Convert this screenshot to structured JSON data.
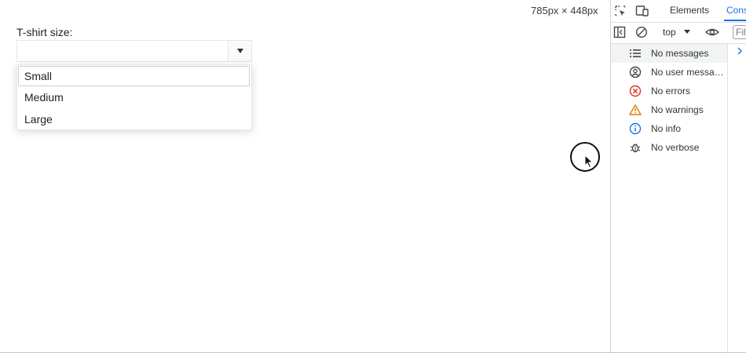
{
  "viewport": {
    "dimensions": "785px × 448px",
    "field_label": "T-shirt size:",
    "select_value": "",
    "options": [
      "Small",
      "Medium",
      "Large"
    ]
  },
  "devtools": {
    "tabs": {
      "elements": "Elements",
      "console": "Cons"
    },
    "context": "top",
    "filter_placeholder": "Filt",
    "sidebar": [
      {
        "label": "No messages",
        "icon": "list-icon"
      },
      {
        "label": "No user messa…",
        "icon": "user-icon"
      },
      {
        "label": "No errors",
        "icon": "error-icon"
      },
      {
        "label": "No warnings",
        "icon": "warning-icon"
      },
      {
        "label": "No info",
        "icon": "info-icon"
      },
      {
        "label": "No verbose",
        "icon": "bug-icon"
      }
    ]
  },
  "colors": {
    "accent": "#1a73e8",
    "error": "#d93025",
    "warning": "#e37400",
    "info": "#1a73e8"
  }
}
